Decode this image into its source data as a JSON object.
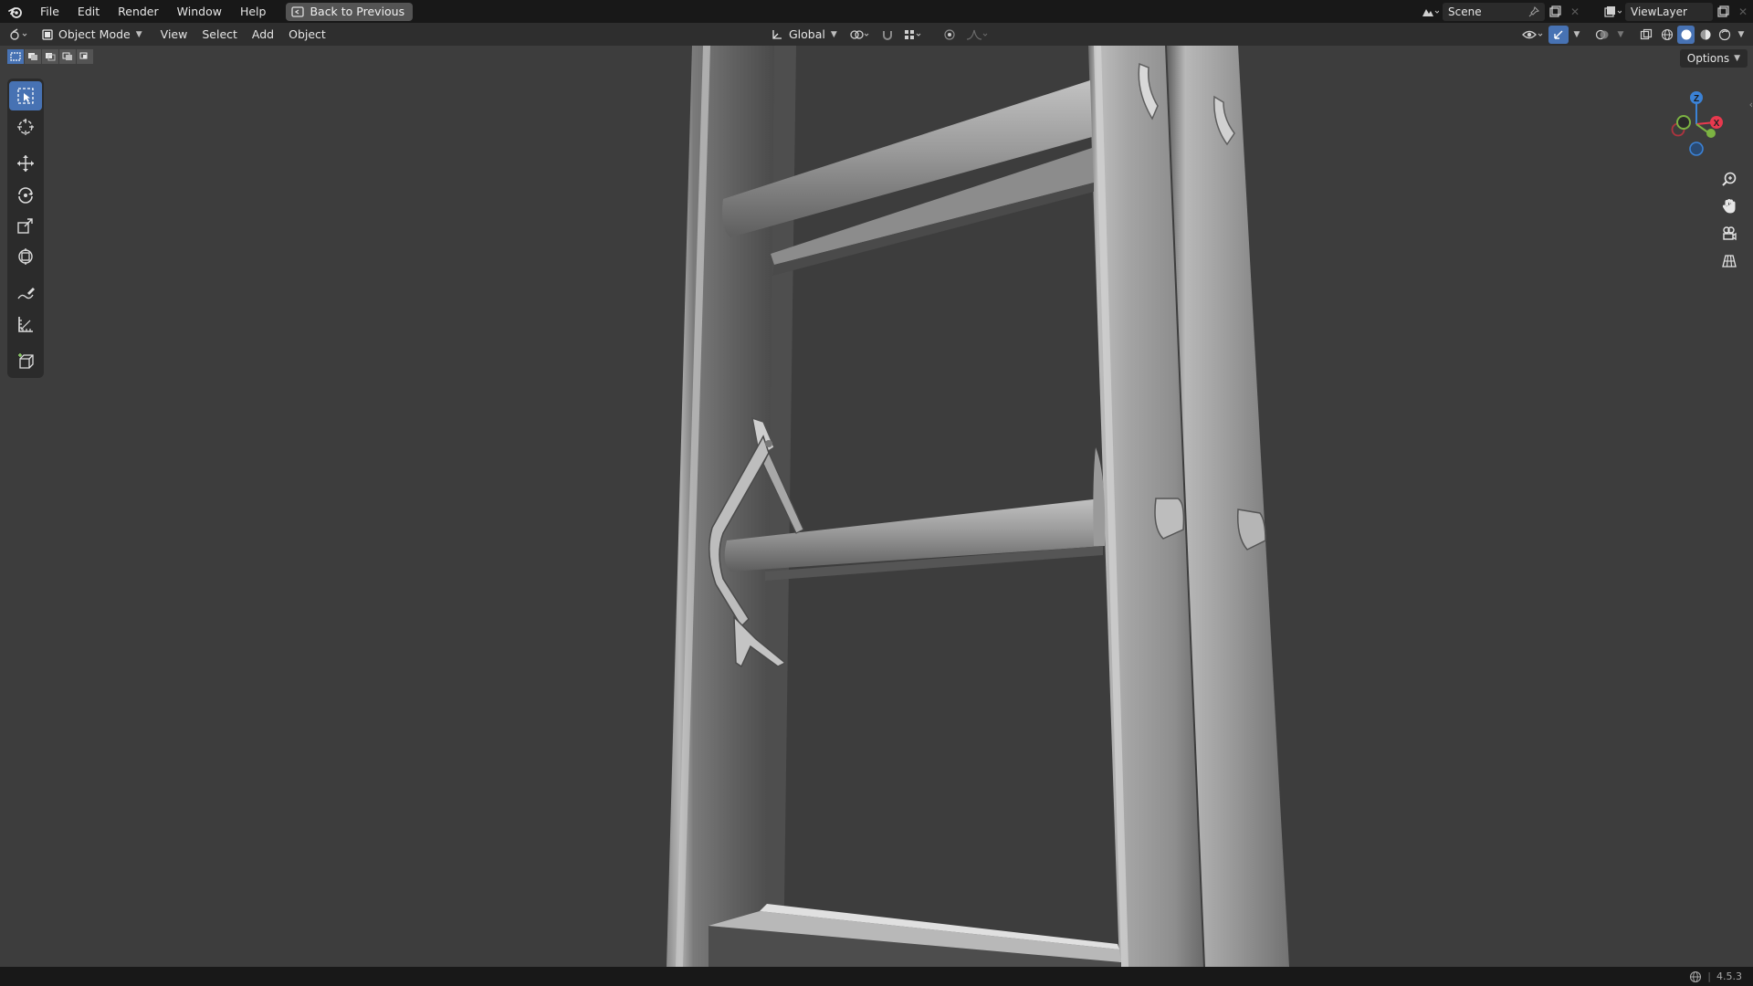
{
  "topbar": {
    "menus": [
      "File",
      "Edit",
      "Render",
      "Window",
      "Help"
    ],
    "back_label": "Back to Previous",
    "scene_name": "Scene",
    "view_layer": "ViewLayer"
  },
  "header": {
    "mode_label": "Object Mode",
    "menus": [
      "View",
      "Select",
      "Add",
      "Object"
    ],
    "transform_orientation": "Global"
  },
  "viewport": {
    "options_label": "Options",
    "gizmo": {
      "x_label": "X",
      "z_label": "Z"
    }
  },
  "statusbar": {
    "version": "4.5.3"
  },
  "colors": {
    "accent": "#4772b3",
    "axis_x": "#e8394e",
    "axis_y": "#7cb342",
    "axis_z": "#3b82d6",
    "background": "#3d3d3d"
  },
  "icons": {
    "logo": "blender-logo-icon",
    "tools": [
      "select-box-icon",
      "cursor-icon",
      "move-icon",
      "rotate-icon",
      "scale-icon",
      "transform-icon",
      "annotate-icon",
      "measure-icon",
      "add-cube-icon"
    ]
  }
}
